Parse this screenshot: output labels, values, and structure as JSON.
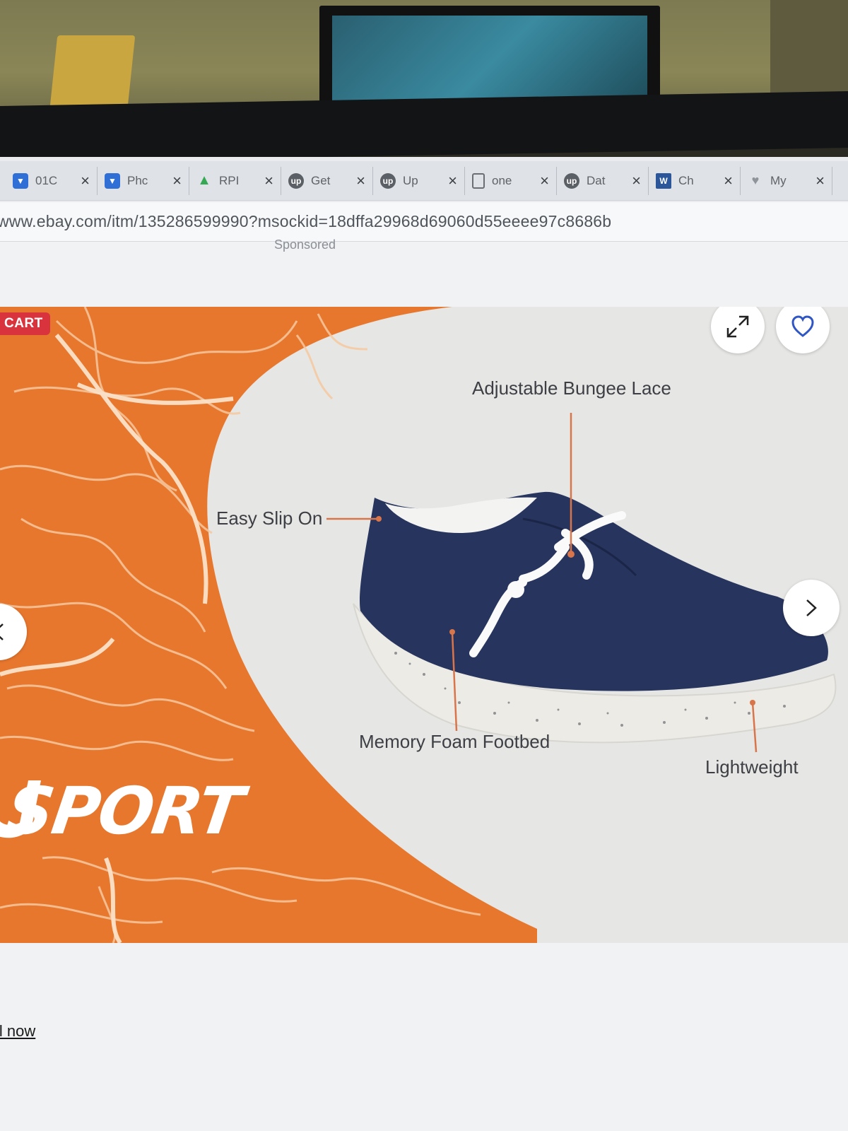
{
  "browser": {
    "tabs": [
      {
        "title": "01C",
        "icon": "shield-icon"
      },
      {
        "title": "Phc",
        "icon": "shield-icon"
      },
      {
        "title": "RPI",
        "icon": "drive-icon"
      },
      {
        "title": "Get",
        "icon": "upwork-icon"
      },
      {
        "title": "Up",
        "icon": "upwork-icon"
      },
      {
        "title": "one",
        "icon": "document-icon"
      },
      {
        "title": "Dat",
        "icon": "upwork-icon"
      },
      {
        "title": "Ch",
        "icon": "word-icon"
      },
      {
        "title": "My",
        "icon": "heart-icon"
      }
    ],
    "url": "www.ebay.com/itm/135286599990?msockid=18dffa29968d69060d55eeee97c8686b"
  },
  "page": {
    "sponsored_label": "Sponsored",
    "sell_link": "ll now"
  },
  "product_image": {
    "cart_badge": "CART",
    "brand": "SPORT",
    "callouts": {
      "bungee": "Adjustable Bungee Lace",
      "slip_on": "Easy Slip On",
      "footbed": "Memory Foam Footbed",
      "lightweight": "Lightweight"
    },
    "colors": {
      "orange": "#e8772e",
      "shoe_navy": "#27345e",
      "sole": "#ecebe6",
      "callout_line": "#d8754a"
    }
  }
}
